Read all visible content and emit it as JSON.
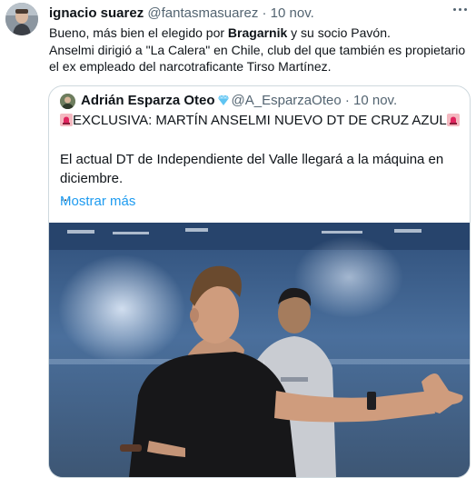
{
  "tweet": {
    "author_name": "ignacio suarez",
    "handle": "@fantasmasuarez",
    "separator": "·",
    "time": "10 nov.",
    "body": {
      "line1_prefix": "Bueno, más bien el elegido por ",
      "line1_bold": "Bragarnik",
      "line1_suffix": " y su socio Pavón.",
      "line2": "Anselmi dirigió a \"La Calera\" en Chile, club del que también es propietario",
      "line3": "el ex empleado del narcotraficante Tirso Martínez."
    }
  },
  "quote": {
    "author_name": "Adrián Esparza Oteo",
    "handle": "@A_EsparzaOteo",
    "separator": "·",
    "time": "10 nov.",
    "headline": "EXCLUSIVA: MARTÍN ANSELMI NUEVO DT DE CRUZ AZUL",
    "body_line1": "El actual DT de Independiente del Valle llegará a la máquina en",
    "body_line2": "diciembre.",
    "ellipsis": "...",
    "show_more": "Mostrar más"
  },
  "icons": {
    "more": "more-options-icon",
    "verified_diamond": "diamond-icon",
    "siren": "siren-icon"
  },
  "colors": {
    "link": "#1d9bf0",
    "text": "#0f1419",
    "secondary": "#536471",
    "border": "#cfd9de"
  }
}
